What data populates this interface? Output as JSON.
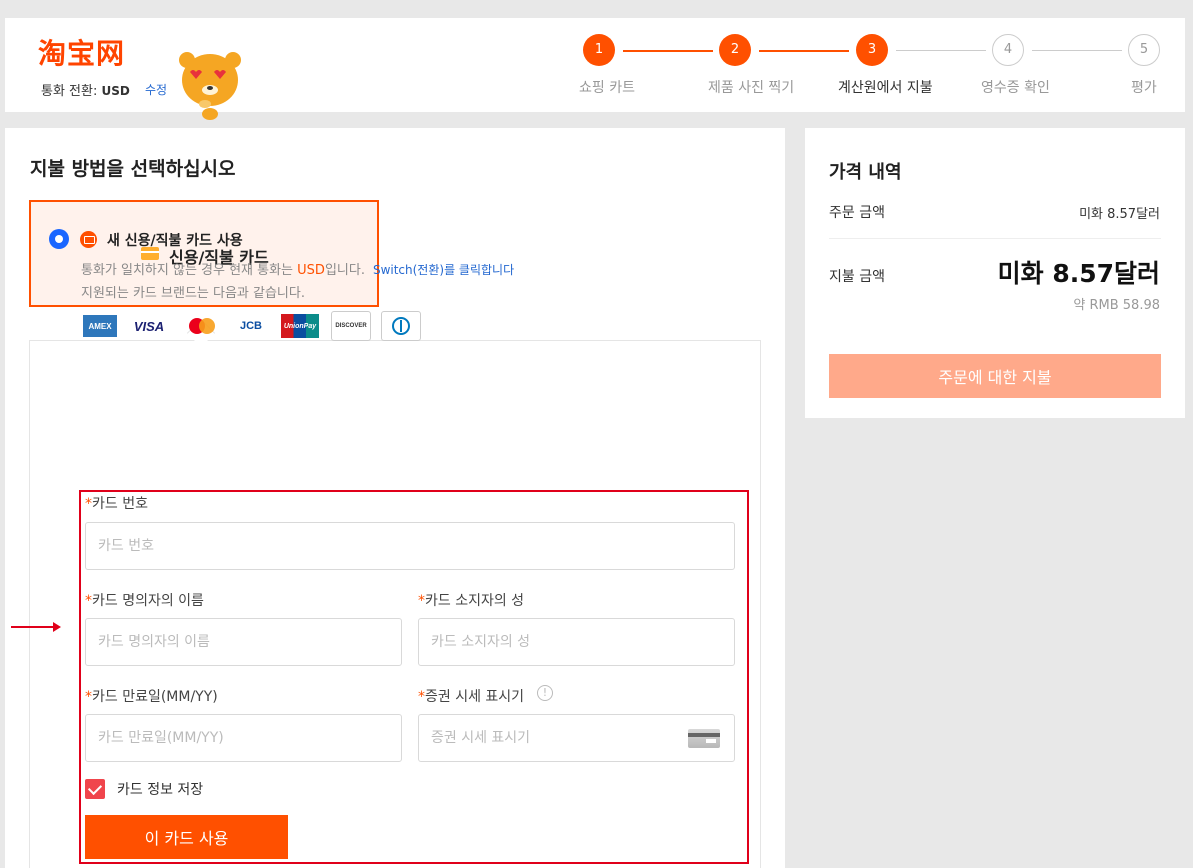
{
  "header": {
    "logo_text": "淘宝网",
    "currency_label": "통화 전환: ",
    "currency_code": "USD",
    "currency_edit": "수정"
  },
  "steps": [
    {
      "number": "1",
      "label": "쇼핑 카트",
      "state": "done"
    },
    {
      "number": "2",
      "label": "제품 사진 찍기",
      "state": "done"
    },
    {
      "number": "3",
      "label": "계산원에서 지불",
      "state": "active"
    },
    {
      "number": "4",
      "label": "영수증 확인",
      "state": "todo"
    },
    {
      "number": "5",
      "label": "평가",
      "state": "todo"
    }
  ],
  "payment": {
    "title": "지불 방법을 선택하십시오",
    "method_tab_label": "신용/직불 카드",
    "new_card_label": "새 신용/직불 카드 사용",
    "notice_prefix": "통화가 일치하지 않는 경우 현재 통화는 ",
    "notice_currency": "USD",
    "notice_suffix": "입니다.",
    "switch_link": "Switch(전환)를 클릭합니다",
    "supported_brands_text": "지원되는 카드 브랜드는 다음과 같습니다.",
    "brands": [
      "AMEX",
      "VISA",
      "Mastercard",
      "JCB",
      "UnionPay",
      "DISCOVER",
      "Diners Club"
    ]
  },
  "form": {
    "required_mark": "*",
    "card_number_label": "카드 번호",
    "card_number_placeholder": "카드 번호",
    "holder_first_label": "카드 명의자의 이름",
    "holder_first_placeholder": "카드 명의자의 이름",
    "holder_last_label": "카드 소지자의 성",
    "holder_last_placeholder": "카드 소지자의 성",
    "expiry_label": "카드 만료일(MM/YY)",
    "expiry_placeholder": "카드 만료일(MM/YY)",
    "cvv_label": "증권 시세 표시기",
    "cvv_placeholder": "증권 시세 표시기",
    "save_card_label": "카드 정보 저장",
    "save_card_checked": true,
    "use_card_button": "이 카드 사용"
  },
  "summary": {
    "title": "가격 내역",
    "order_amount_label": "주문 금액",
    "order_amount_value": "미화 8.57달러",
    "pay_amount_label": "지불 금액",
    "pay_amount_value": "미화 8.57달러",
    "rmb_value": "약 RMB 58.98",
    "pay_button": "주문에 대한 지불"
  },
  "colors": {
    "accent": "#ff5000",
    "link": "#2468d0",
    "highlight_frame": "#e0001a"
  }
}
